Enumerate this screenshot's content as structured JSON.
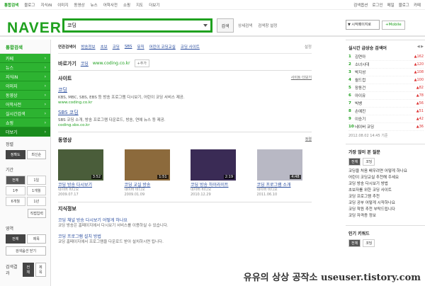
{
  "topnav": {
    "items": [
      "통합검색",
      "블로그",
      "지식iN",
      "이미지",
      "동영상",
      "뉴스",
      "어학사전",
      "쇼핑",
      "지도",
      "더보기"
    ],
    "right": [
      "검색옵션",
      "로그인",
      "메일",
      "블로그",
      "카페"
    ]
  },
  "header": {
    "logo": "NAVER",
    "query": "코딩",
    "search_label": "검색",
    "options": [
      "상세검색",
      "검색창 설정"
    ],
    "select_value": "▼ 시작페이지로",
    "mobile_label": "+Mobile"
  },
  "sidebar": {
    "title": "통합검색",
    "items": [
      "카페",
      "뉴스",
      "지식iN",
      "이미지",
      "동영상",
      "어학사전",
      "실시간검색",
      "쇼핑"
    ],
    "more": "더보기",
    "sort_title": "정렬",
    "sort_options": [
      "정확도",
      "최신순"
    ],
    "period_title": "기간",
    "periods": [
      "전체",
      "1일",
      "1주",
      "1개월",
      "6개월",
      "1년"
    ],
    "apply_label": "직접입력",
    "area_title": "영역",
    "area_options": [
      "전체",
      "제목"
    ],
    "area_apply": "검색옵션 닫기",
    "footer_label": "검색결과",
    "footer_options": [
      "전체",
      "제목"
    ]
  },
  "tabs": {
    "items": [
      "연관검색어",
      "방송정보",
      "초보",
      "코딩",
      "SBS",
      "뮤직",
      "어린이 코딩교실",
      "코딩 사이트"
    ],
    "setting": "설정"
  },
  "shortcut": {
    "label": "바로가기",
    "name": "코딩",
    "url": "www.coding.co.kr",
    "add": "+추가"
  },
  "site": {
    "title": "사이트",
    "more": "사이트 더보기",
    "items": [
      {
        "title": "코딩",
        "desc": "KBS, MBC, SBS, EBS 등 방송 프로그램 다시보기, 어린이 코딩 서비스 제공.",
        "link": "www.coding.co.kr"
      },
      {
        "title": "SBS 코딩",
        "desc": "SBS 코딩 소개, 방송 프로그램 다운로드, 방송, 연예 뉴스 등 제공.",
        "link": "coding.sbs.co.kr"
      }
    ]
  },
  "video": {
    "title": "동영상",
    "sort": "정렬",
    "items": [
      {
        "title": "코딩 방송 다시보기",
        "dur": "3:52",
        "source": "네이버 비디오",
        "date": "2009.07.17",
        "color": "#4a5d3a"
      },
      {
        "title": "코딩 교실 방송",
        "dur": "1:51",
        "source": "네이버 비디오",
        "date": "2009.01.09",
        "color": "#8c6a3c"
      },
      {
        "title": "코딩 방송 하이라이트",
        "dur": "2:19",
        "source": "네이버 비디오",
        "date": "2010.12.29",
        "color": "#3a2b55"
      },
      {
        "title": "코딩 프로그램 소개",
        "dur": "4:48",
        "source": "네이버 비디오",
        "date": "2011.06.10",
        "color": "#b8b8c4"
      }
    ]
  },
  "knowledge": {
    "title": "지식정보",
    "items": [
      {
        "q": "코딩 채널 방송 다시보기 어떻게 하나요",
        "a": "코딩 방송은 홈페이지에서 다시보기 서비스를 이용하실 수 있습니다."
      },
      {
        "q": "코딩 프로그램 설치 방법",
        "a": "코딩 홈페이지에서 프로그램을 다운로드 받아 설치하시면 됩니다."
      }
    ]
  },
  "realtime": {
    "title": "실시간 급상승 검색어",
    "nav": "◀ ▶",
    "items": [
      {
        "k": "김연아",
        "v": "▲162"
      },
      {
        "k": "소녀시대",
        "v": "▲120"
      },
      {
        "k": "박지성",
        "v": "▲108"
      },
      {
        "k": "월드컵",
        "v": "▲100"
      },
      {
        "k": "장동건",
        "v": "▲82"
      },
      {
        "k": "아이유",
        "v": "▲78"
      },
      {
        "k": "빅뱅",
        "v": "▲56"
      },
      {
        "k": "손예진",
        "v": "▲51"
      },
      {
        "k": "이승기",
        "v": "▲42"
      },
      {
        "k": "네이버 코딩",
        "v": "▲36"
      }
    ],
    "time": "2012.08.02 14:45 기준"
  },
  "questions": {
    "title": "가장 많이 본 질문",
    "tabs": [
      "전체",
      "코딩"
    ],
    "items": [
      "코딩을 처음 배우려면 어떻게 하나요",
      "어린이 코딩교실 추천해 주세요",
      "코딩 방송 다시보기 방법",
      "초보자를 위한 코딩 사이트",
      "코딩 프로그램 추천",
      "코딩 공부 어떻게 시작하나요",
      "코딩 학원 추천 부탁드립니다",
      "코딩 자격증 정보"
    ]
  },
  "hotkeywords": {
    "title": "인기 키워드",
    "tabs": [
      "전체",
      "코딩"
    ]
  },
  "watermark": "유유의 상상 공작소 useuser.tistory.com"
}
